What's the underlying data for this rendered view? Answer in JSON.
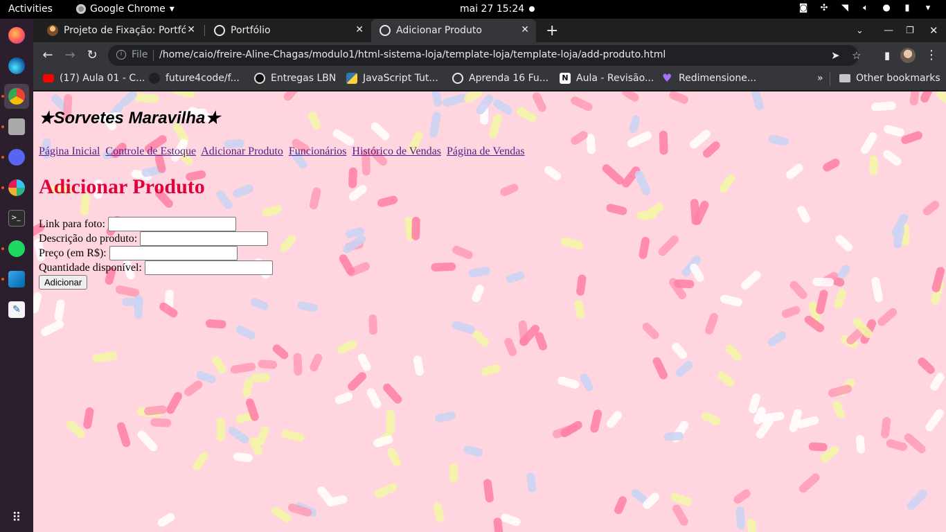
{
  "topbar": {
    "activities": "Activities",
    "app_name": "Google Chrome",
    "clock": "mai 27  15:24"
  },
  "dock": {
    "apps": [
      "firefox",
      "edge",
      "chrome",
      "files",
      "discord",
      "slack",
      "terminal",
      "spotify",
      "vscode",
      "text-editor",
      "app-grid"
    ]
  },
  "browser": {
    "tabs": [
      {
        "title": "Projeto de Fixação: Portfó",
        "active": false
      },
      {
        "title": "Portfólio",
        "active": false
      },
      {
        "title": "Adicionar Produto",
        "active": true
      }
    ],
    "new_tab_label": "+",
    "omnibox": {
      "scheme": "File",
      "url": "/home/caio/freire-Aline-Chagas/modulo1/html-sistema-loja/template-loja/template-loja/add-produto.html"
    },
    "bookmarks": [
      "(17) Aula 01 - C...",
      "future4code/f...",
      "Entregas LBN",
      "JavaScript Tut...",
      "Aprenda 16 Fu...",
      "Aula - Revisão...",
      "Redimensione..."
    ],
    "overflow": "»",
    "other_bookmarks": "Other bookmarks"
  },
  "page": {
    "site_title": "★Sorvetes Maravilha★",
    "nav": [
      "Página Inicial",
      "Controle de Estoque",
      "Adicionar Produto",
      "Funcionários",
      "Histórico de Vendas",
      "Página de Vendas"
    ],
    "heading": "Adicionar Produto",
    "form": {
      "fields": [
        {
          "label": "Link para foto:",
          "value": ""
        },
        {
          "label": "Descrição do produto:",
          "value": ""
        },
        {
          "label": "Preço (em R$):",
          "value": ""
        },
        {
          "label": "Quantidade disponível:",
          "value": ""
        }
      ],
      "submit": "Adicionar"
    }
  },
  "colors": {
    "page_background": "#ffd6df",
    "heading": "#e0003c",
    "link": "#551a8b",
    "sprinkles": [
      "#ffffff",
      "#ff9bb5",
      "#f3f7a6",
      "#c9d3f5",
      "#ff7fa3"
    ]
  }
}
